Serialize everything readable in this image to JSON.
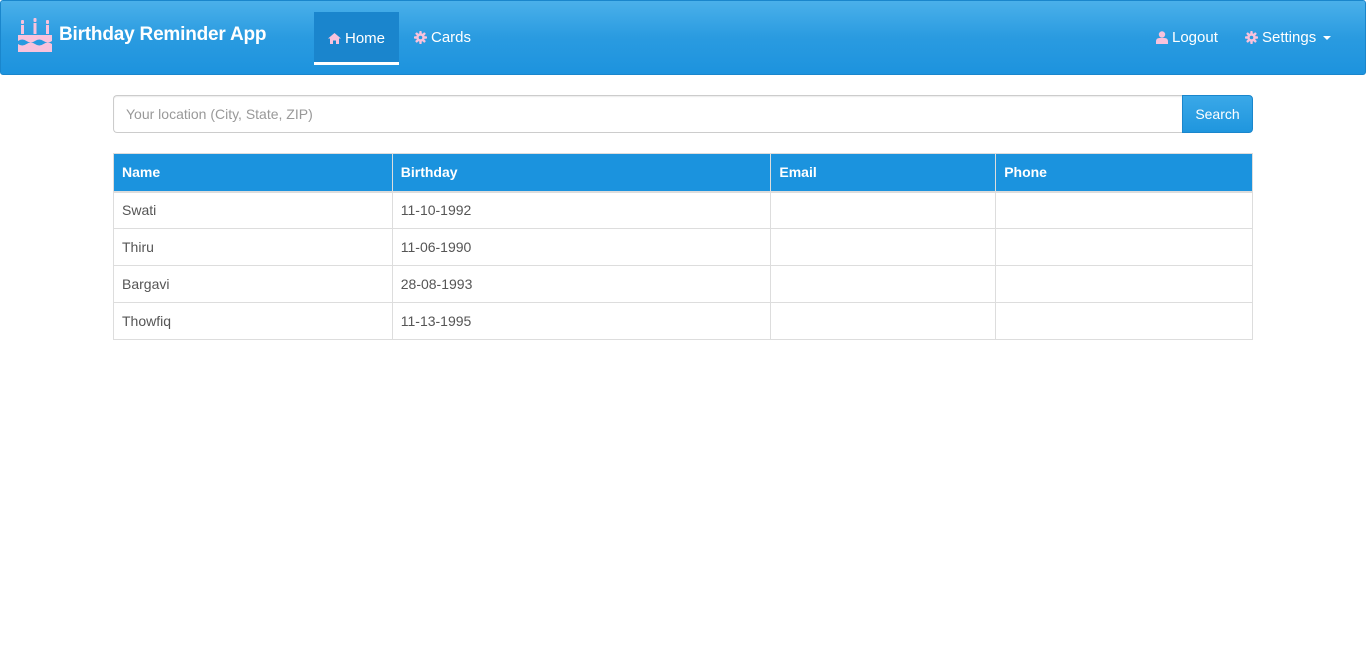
{
  "app": {
    "title": "Birthday Reminder App"
  },
  "nav": {
    "home": {
      "label": "Home",
      "icon": "home-icon"
    },
    "cards": {
      "label": "Cards",
      "icon": "gear-icon"
    },
    "logout": {
      "label": "Logout",
      "icon": "user-icon"
    },
    "settings": {
      "label": "Settings",
      "icon": "gear-icon"
    }
  },
  "search": {
    "placeholder": "Your location (City, State, ZIP)",
    "value": "",
    "button_label": "Search"
  },
  "table": {
    "headers": [
      "Name",
      "Birthday",
      "Email",
      "Phone"
    ],
    "rows": [
      {
        "name": "Swati",
        "birthday": "11-10-1992",
        "email": "",
        "phone": ""
      },
      {
        "name": "Thiru",
        "birthday": "11-06-1990",
        "email": "",
        "phone": ""
      },
      {
        "name": "Bargavi",
        "birthday": "28-08-1993",
        "email": "",
        "phone": ""
      },
      {
        "name": "Thowfiq",
        "birthday": "11-13-1995",
        "email": "",
        "phone": ""
      }
    ]
  },
  "colors": {
    "navbar": "#1d93de",
    "table_header": "#1b93de",
    "icon_pink": "#f9c2dc"
  }
}
